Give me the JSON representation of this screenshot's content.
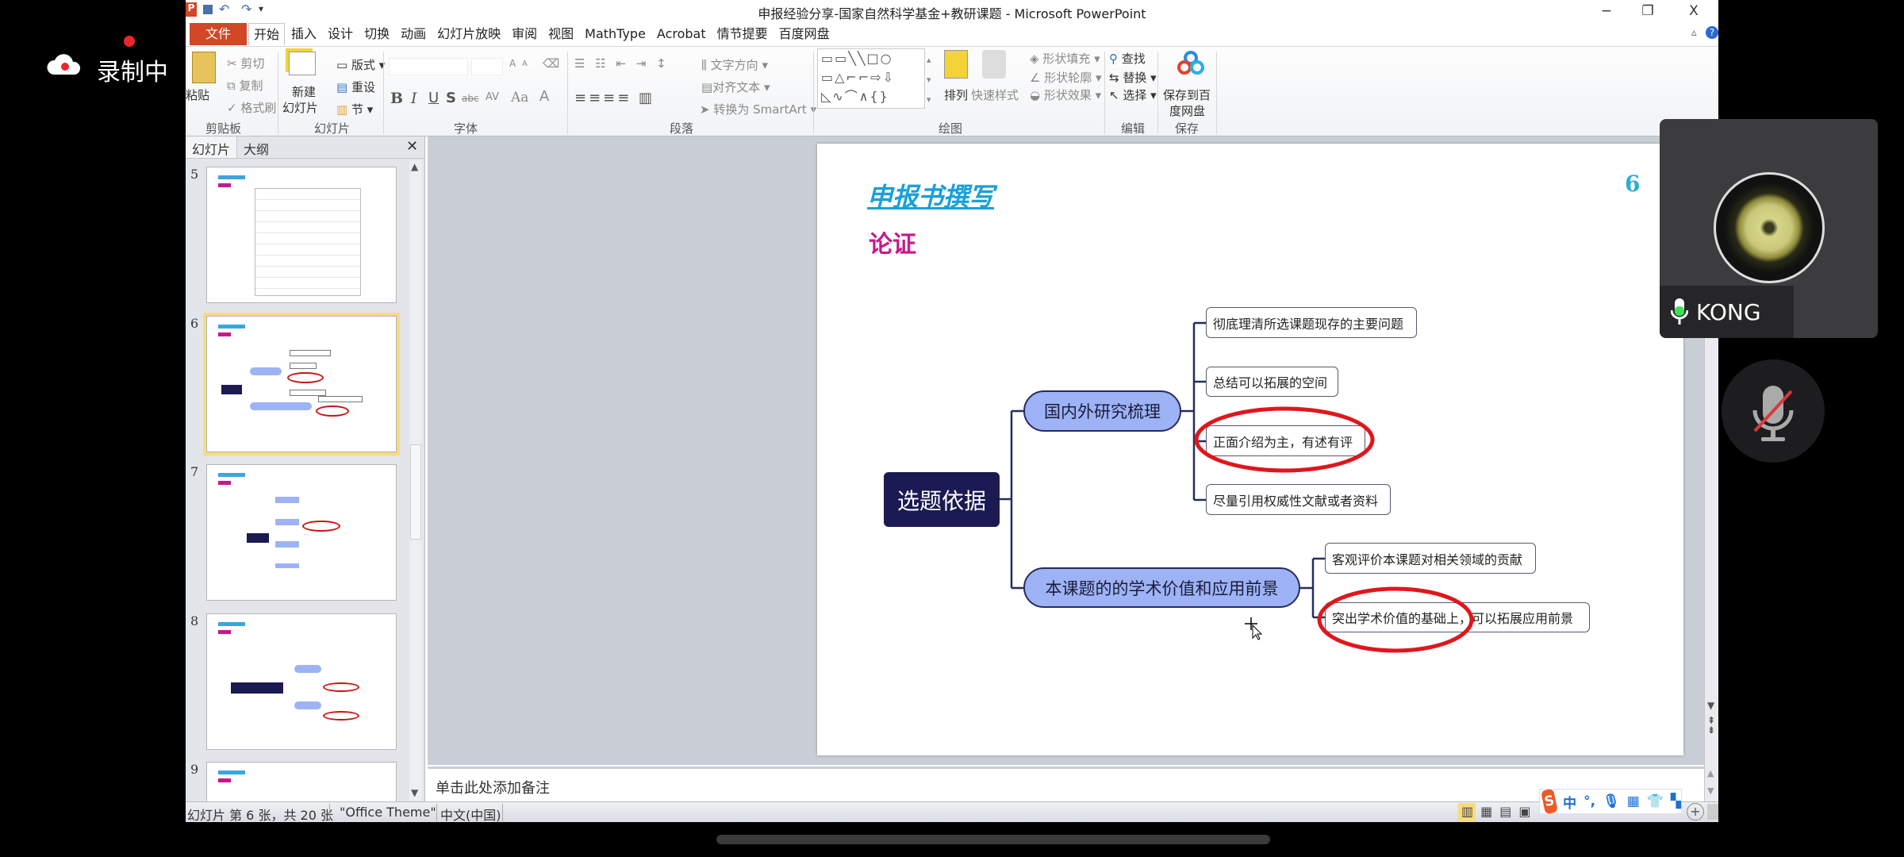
{
  "recording": {
    "label": "录制中",
    "dot_color": "#e8262c"
  },
  "window": {
    "title": "申报经验分享-国家自然科学基金+教研课题 - Microsoft PowerPoint",
    "controls": {
      "minimize": "−",
      "restore": "❐",
      "close": "X"
    }
  },
  "tabs": [
    "文件",
    "开始",
    "插入",
    "设计",
    "切换",
    "动画",
    "幻灯片放映",
    "审阅",
    "视图",
    "MathType",
    "Acrobat",
    "情节提要",
    "百度网盘"
  ],
  "active_tab": "开始",
  "ribbon": {
    "clipboard": {
      "paste": "粘贴",
      "cut": "剪切",
      "copy": "复制",
      "format_painter": "格式刷",
      "label": "剪贴板"
    },
    "slides": {
      "new_slide_1": "新建",
      "new_slide_2": "幻灯片",
      "layout": "版式",
      "reset": "重设",
      "section": "节",
      "label": "幻灯片"
    },
    "font": {
      "bold": "B",
      "italic": "I",
      "underline": "U",
      "shadow": "S",
      "strike": "abc",
      "spacing": "AV",
      "case": "Aa",
      "color": "A",
      "grow": "A",
      "shrink": "A",
      "label": "字体"
    },
    "paragraph": {
      "text_direction": "文字方向",
      "align_text": "对齐文本",
      "smartart": "转换为 SmartArt",
      "label": "段落"
    },
    "drawing": {
      "arrange": "排列",
      "quick_styles": "快速样式",
      "shape_fill": "形状填充",
      "shape_outline": "形状轮廓",
      "shape_effects": "形状效果",
      "label": "绘图"
    },
    "editing": {
      "find": "查找",
      "replace": "替换",
      "select": "选择",
      "label": "编辑"
    },
    "save": {
      "button_1": "保存到百",
      "button_2": "度网盘",
      "label": "保存"
    }
  },
  "left_pane": {
    "tabs": [
      "幻灯片",
      "大纲"
    ],
    "close": "✕",
    "thumbnails": [
      "5",
      "6",
      "7",
      "8",
      "9"
    ],
    "selected": "6"
  },
  "slide": {
    "title": "申报书撰写",
    "subtitle": "论证",
    "number": "6",
    "mindmap": {
      "root": "选题依据",
      "branches": [
        {
          "label": "国内外研究梳理",
          "children": [
            "彻底理清所选课题现存的主要问题",
            "总结可以拓展的空间",
            "正面介绍为主，有述有评",
            "尽量引用权威性文献或者资料"
          ]
        },
        {
          "label": "本课题的的学术价值和应用前景",
          "children": [
            "客观评价本课题对相关领域的贡献",
            "突出学术价值的基础上，可以拓展应用前景"
          ]
        }
      ],
      "highlight_color": "#e0161c",
      "root_color": "#1c1a52",
      "branch_color": "#9db3f5"
    }
  },
  "notes": {
    "placeholder": "单击此处添加备注"
  },
  "status": {
    "slide_info": "幻灯片 第 6 张，共 20 张",
    "theme": "\"Office Theme\"",
    "language": "中文(中国)"
  },
  "ime": {
    "logo": "S",
    "mode": "中",
    "punct": "°,"
  },
  "participant": {
    "name": "KONG",
    "mic": "on"
  },
  "mute_button": {
    "state": "muted"
  }
}
